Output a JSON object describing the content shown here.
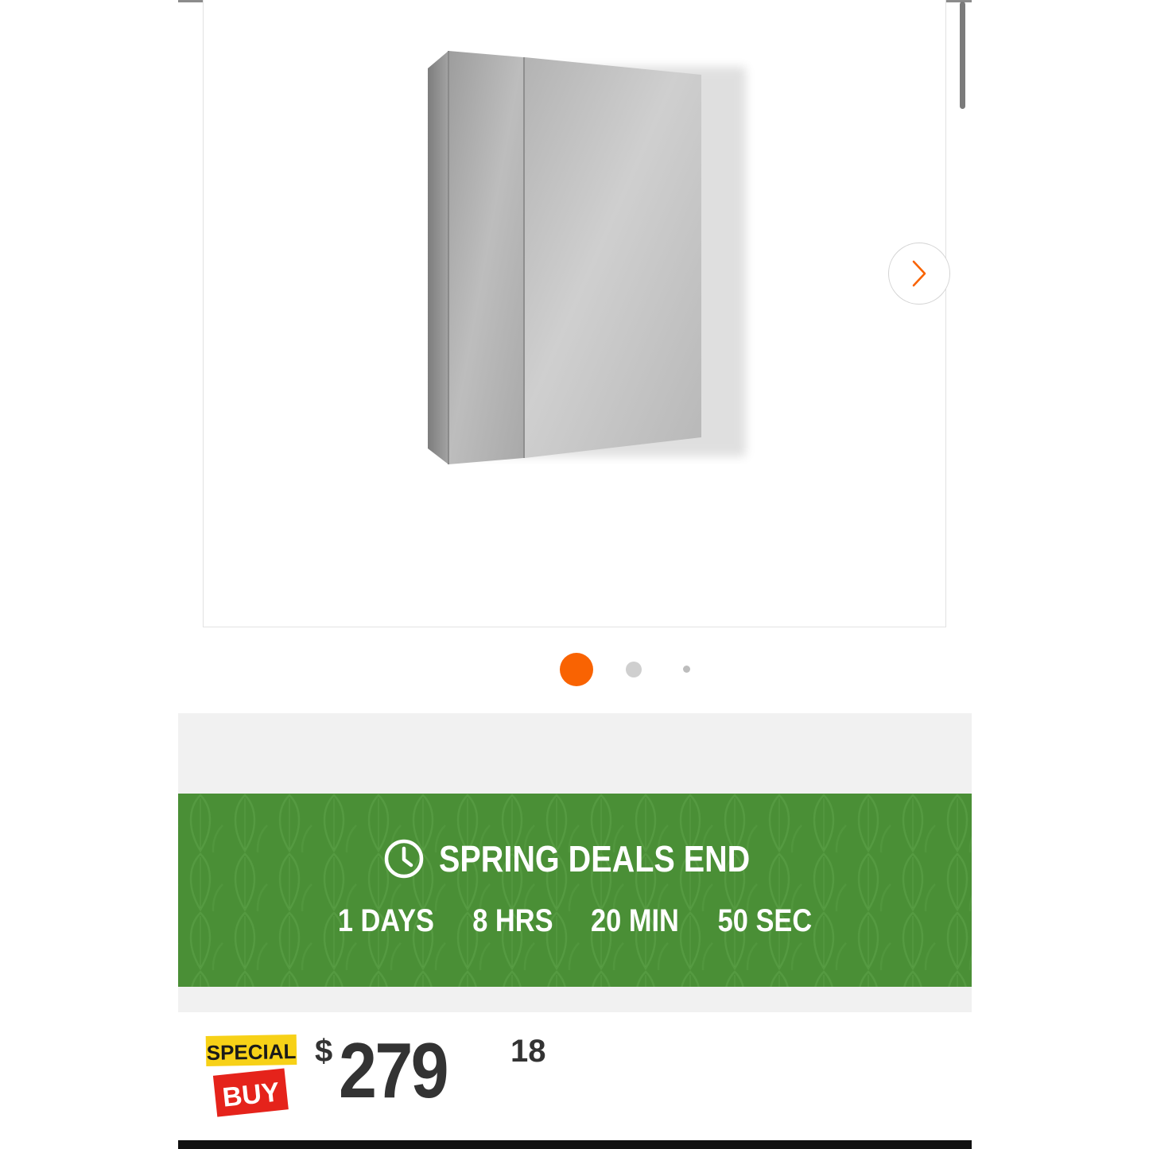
{
  "gallery": {
    "next_icon": "chevron-right-icon",
    "slide_count": 3,
    "active_slide": 1,
    "accent_color": "#f96302"
  },
  "promo": {
    "icon": "clock-icon",
    "title": "SPRING DEALS END",
    "countdown": {
      "days": "1 DAYS",
      "hours": "8 HRS",
      "minutes": "20 MIN",
      "seconds": "50 SEC"
    },
    "banner_color": "#4a8f36"
  },
  "price": {
    "badge_top": "SPECIAL",
    "badge_bottom": "BUY",
    "currency": "$",
    "dollars": "279",
    "cents": "18"
  }
}
